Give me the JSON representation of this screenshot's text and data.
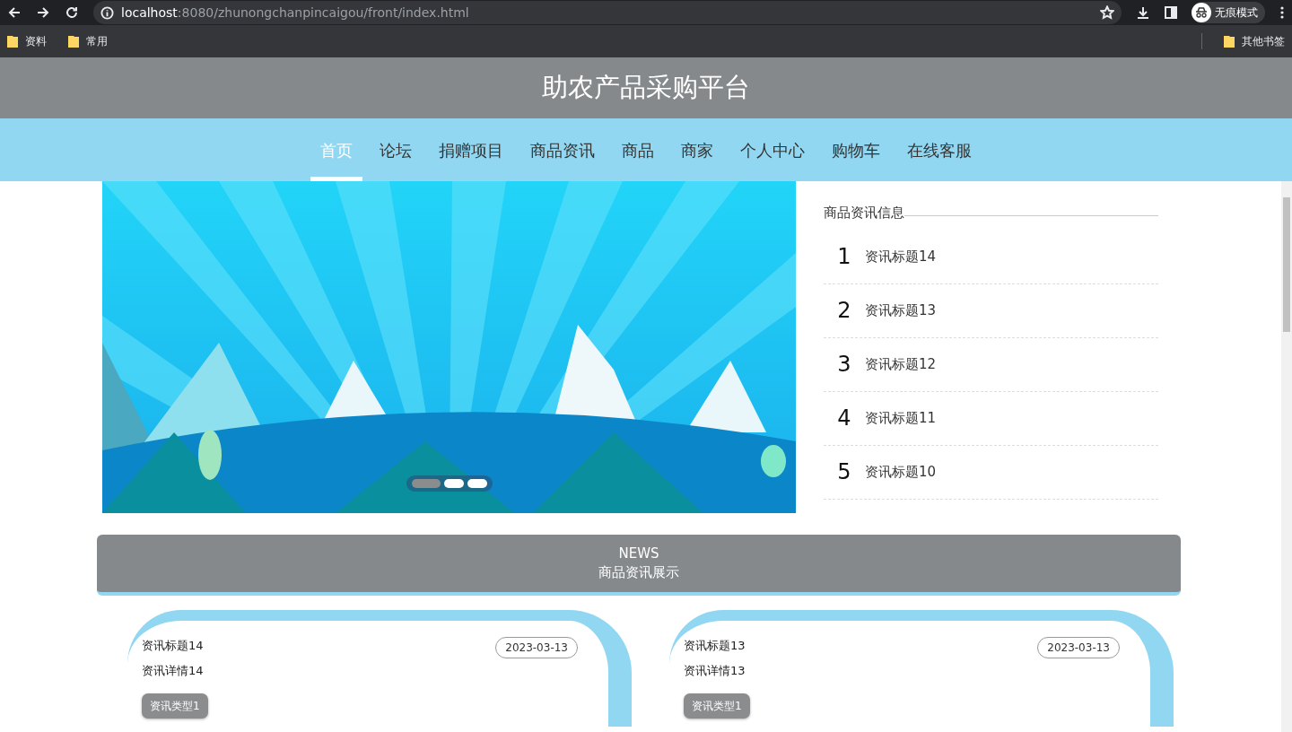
{
  "browser": {
    "url_host": "localhost",
    "url_rest": ":8080/zhunongchanpincaigou/front/index.html",
    "incognito_label": "无痕模式",
    "bookmarks": [
      "资料",
      "常用"
    ],
    "other_bookmarks": "其他书签"
  },
  "site": {
    "title": "助农产品采购平台",
    "nav": [
      {
        "label": "首页",
        "selected": true
      },
      {
        "label": "论坛",
        "selected": false
      },
      {
        "label": "捐赠项目",
        "selected": false
      },
      {
        "label": "商品资讯",
        "selected": false
      },
      {
        "label": "商品",
        "selected": false
      },
      {
        "label": "商家",
        "selected": false
      },
      {
        "label": "个人中心",
        "selected": false
      },
      {
        "label": "购物车",
        "selected": false
      },
      {
        "label": "在线客服",
        "selected": false
      }
    ]
  },
  "carousel": {
    "indicators": [
      {
        "selected": true
      },
      {
        "selected": false
      },
      {
        "selected": false
      }
    ]
  },
  "news_sidebar": {
    "title": "商品资讯信息",
    "items": [
      {
        "rank": "1",
        "title": "资讯标题14"
      },
      {
        "rank": "2",
        "title": "资讯标题13"
      },
      {
        "rank": "3",
        "title": "资讯标题12"
      },
      {
        "rank": "4",
        "title": "资讯标题11"
      },
      {
        "rank": "5",
        "title": "资讯标题10"
      }
    ]
  },
  "news_section": {
    "label": "NEWS",
    "title": "商品资讯展示",
    "cards": [
      {
        "title": "资讯标题14",
        "detail": "资讯详情14",
        "date": "2023-03-13",
        "tag": "资讯类型1"
      },
      {
        "title": "资讯标题13",
        "detail": "资讯详情13",
        "date": "2023-03-13",
        "tag": "资讯类型1"
      }
    ]
  }
}
